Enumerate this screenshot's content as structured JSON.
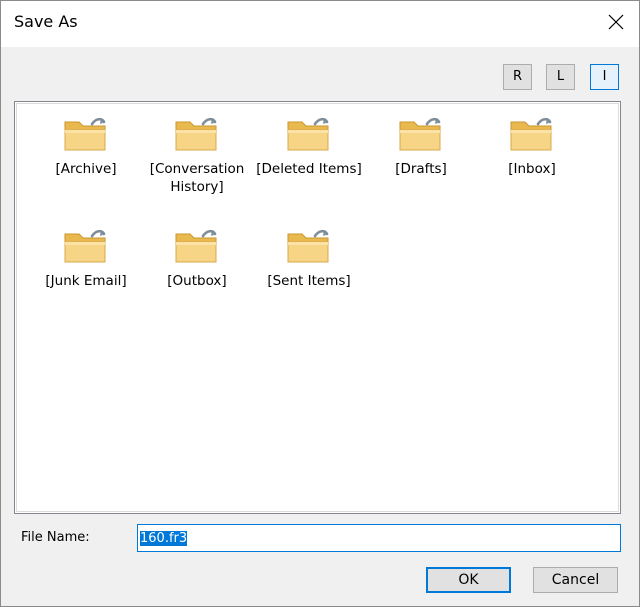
{
  "window": {
    "title": "Save As",
    "close_icon": "close-icon"
  },
  "view_buttons": [
    {
      "label": "R",
      "active": false
    },
    {
      "label": "L",
      "active": false
    },
    {
      "label": "I",
      "active": true
    }
  ],
  "folders": [
    {
      "label": "[Archive]",
      "icon": "folder-shortcut-icon"
    },
    {
      "label": "[Conversation History]",
      "icon": "folder-shortcut-icon"
    },
    {
      "label": "[Deleted Items]",
      "icon": "folder-shortcut-icon"
    },
    {
      "label": "[Drafts]",
      "icon": "folder-shortcut-icon"
    },
    {
      "label": "[Inbox]",
      "icon": "folder-shortcut-icon"
    },
    {
      "label": "[Junk Email]",
      "icon": "folder-shortcut-icon"
    },
    {
      "label": "[Outbox]",
      "icon": "folder-shortcut-icon"
    },
    {
      "label": "[Sent Items]",
      "icon": "folder-shortcut-icon"
    }
  ],
  "file_name": {
    "label": "File Name:",
    "value": "160.fr3"
  },
  "buttons": {
    "ok": "OK",
    "cancel": "Cancel"
  },
  "colors": {
    "accent": "#0078d7",
    "folder": "#f5cf78"
  }
}
